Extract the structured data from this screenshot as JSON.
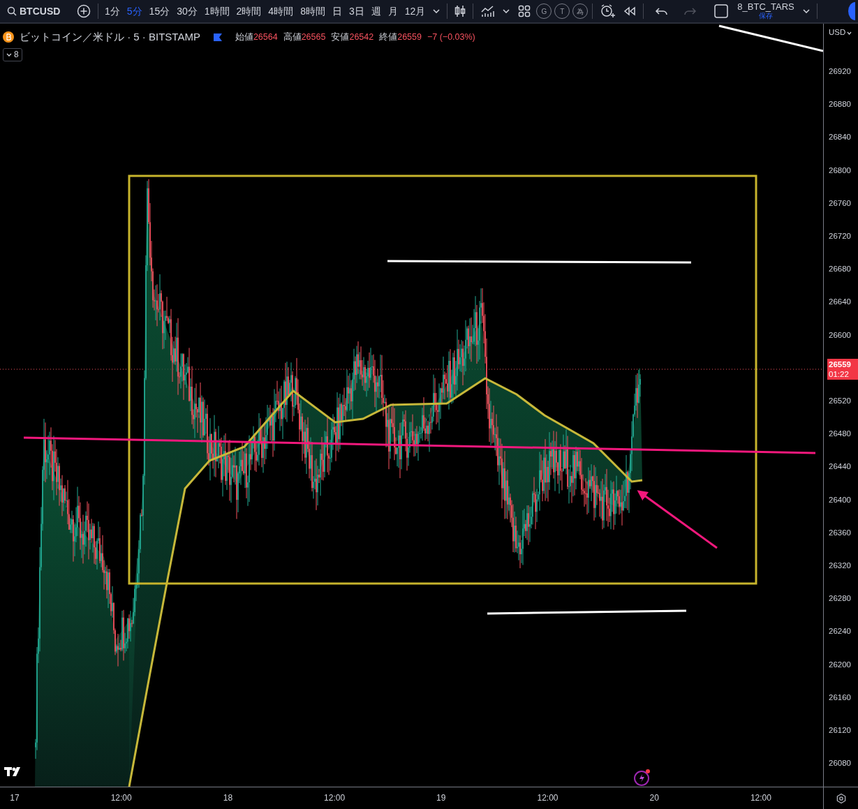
{
  "toolbar": {
    "symbol": "BTCUSD",
    "intervals": [
      {
        "label": "1分",
        "selected": false
      },
      {
        "label": "5分",
        "selected": true
      },
      {
        "label": "15分",
        "selected": false
      },
      {
        "label": "30分",
        "selected": false
      },
      {
        "label": "1時間",
        "selected": false
      },
      {
        "label": "2時間",
        "selected": false
      },
      {
        "label": "4時間",
        "selected": false
      },
      {
        "label": "8時間",
        "selected": false
      },
      {
        "label": "日",
        "selected": false
      },
      {
        "label": "3日",
        "selected": false
      },
      {
        "label": "週",
        "selected": false
      },
      {
        "label": "月",
        "selected": false
      },
      {
        "label": "12月",
        "selected": false
      }
    ],
    "circle_buttons": [
      "G",
      "T",
      "為"
    ],
    "history": [
      {
        "kind": "undo",
        "disabled": false
      },
      {
        "kind": "redo",
        "disabled": true
      }
    ],
    "layout": {
      "name": "8_BTC_TARS",
      "status": "保存"
    }
  },
  "legend": {
    "title": "ビットコイン／米ドル · 5 · BITSTAMP",
    "ohlc": [
      {
        "label": "始値",
        "value": "26564"
      },
      {
        "label": "高値",
        "value": "26565"
      },
      {
        "label": "安値",
        "value": "26542"
      },
      {
        "label": "終値",
        "value": "26559"
      }
    ],
    "change": "−7 (−0.03%)",
    "indicator_count": "8"
  },
  "price_axis": {
    "currency": "USD",
    "ticks": [
      "26920",
      "26880",
      "26840",
      "26800",
      "26760",
      "26720",
      "26680",
      "26640",
      "26600",
      "26520",
      "26480",
      "26440",
      "26400",
      "26360",
      "26320",
      "26280",
      "26240",
      "26200",
      "26160",
      "26120",
      "26080"
    ],
    "last_price": "26559",
    "countdown": "01:22"
  },
  "time_axis": {
    "ticks": [
      "17",
      "12:00",
      "18",
      "12:00",
      "19",
      "12:00",
      "20",
      "12:00"
    ]
  }
}
